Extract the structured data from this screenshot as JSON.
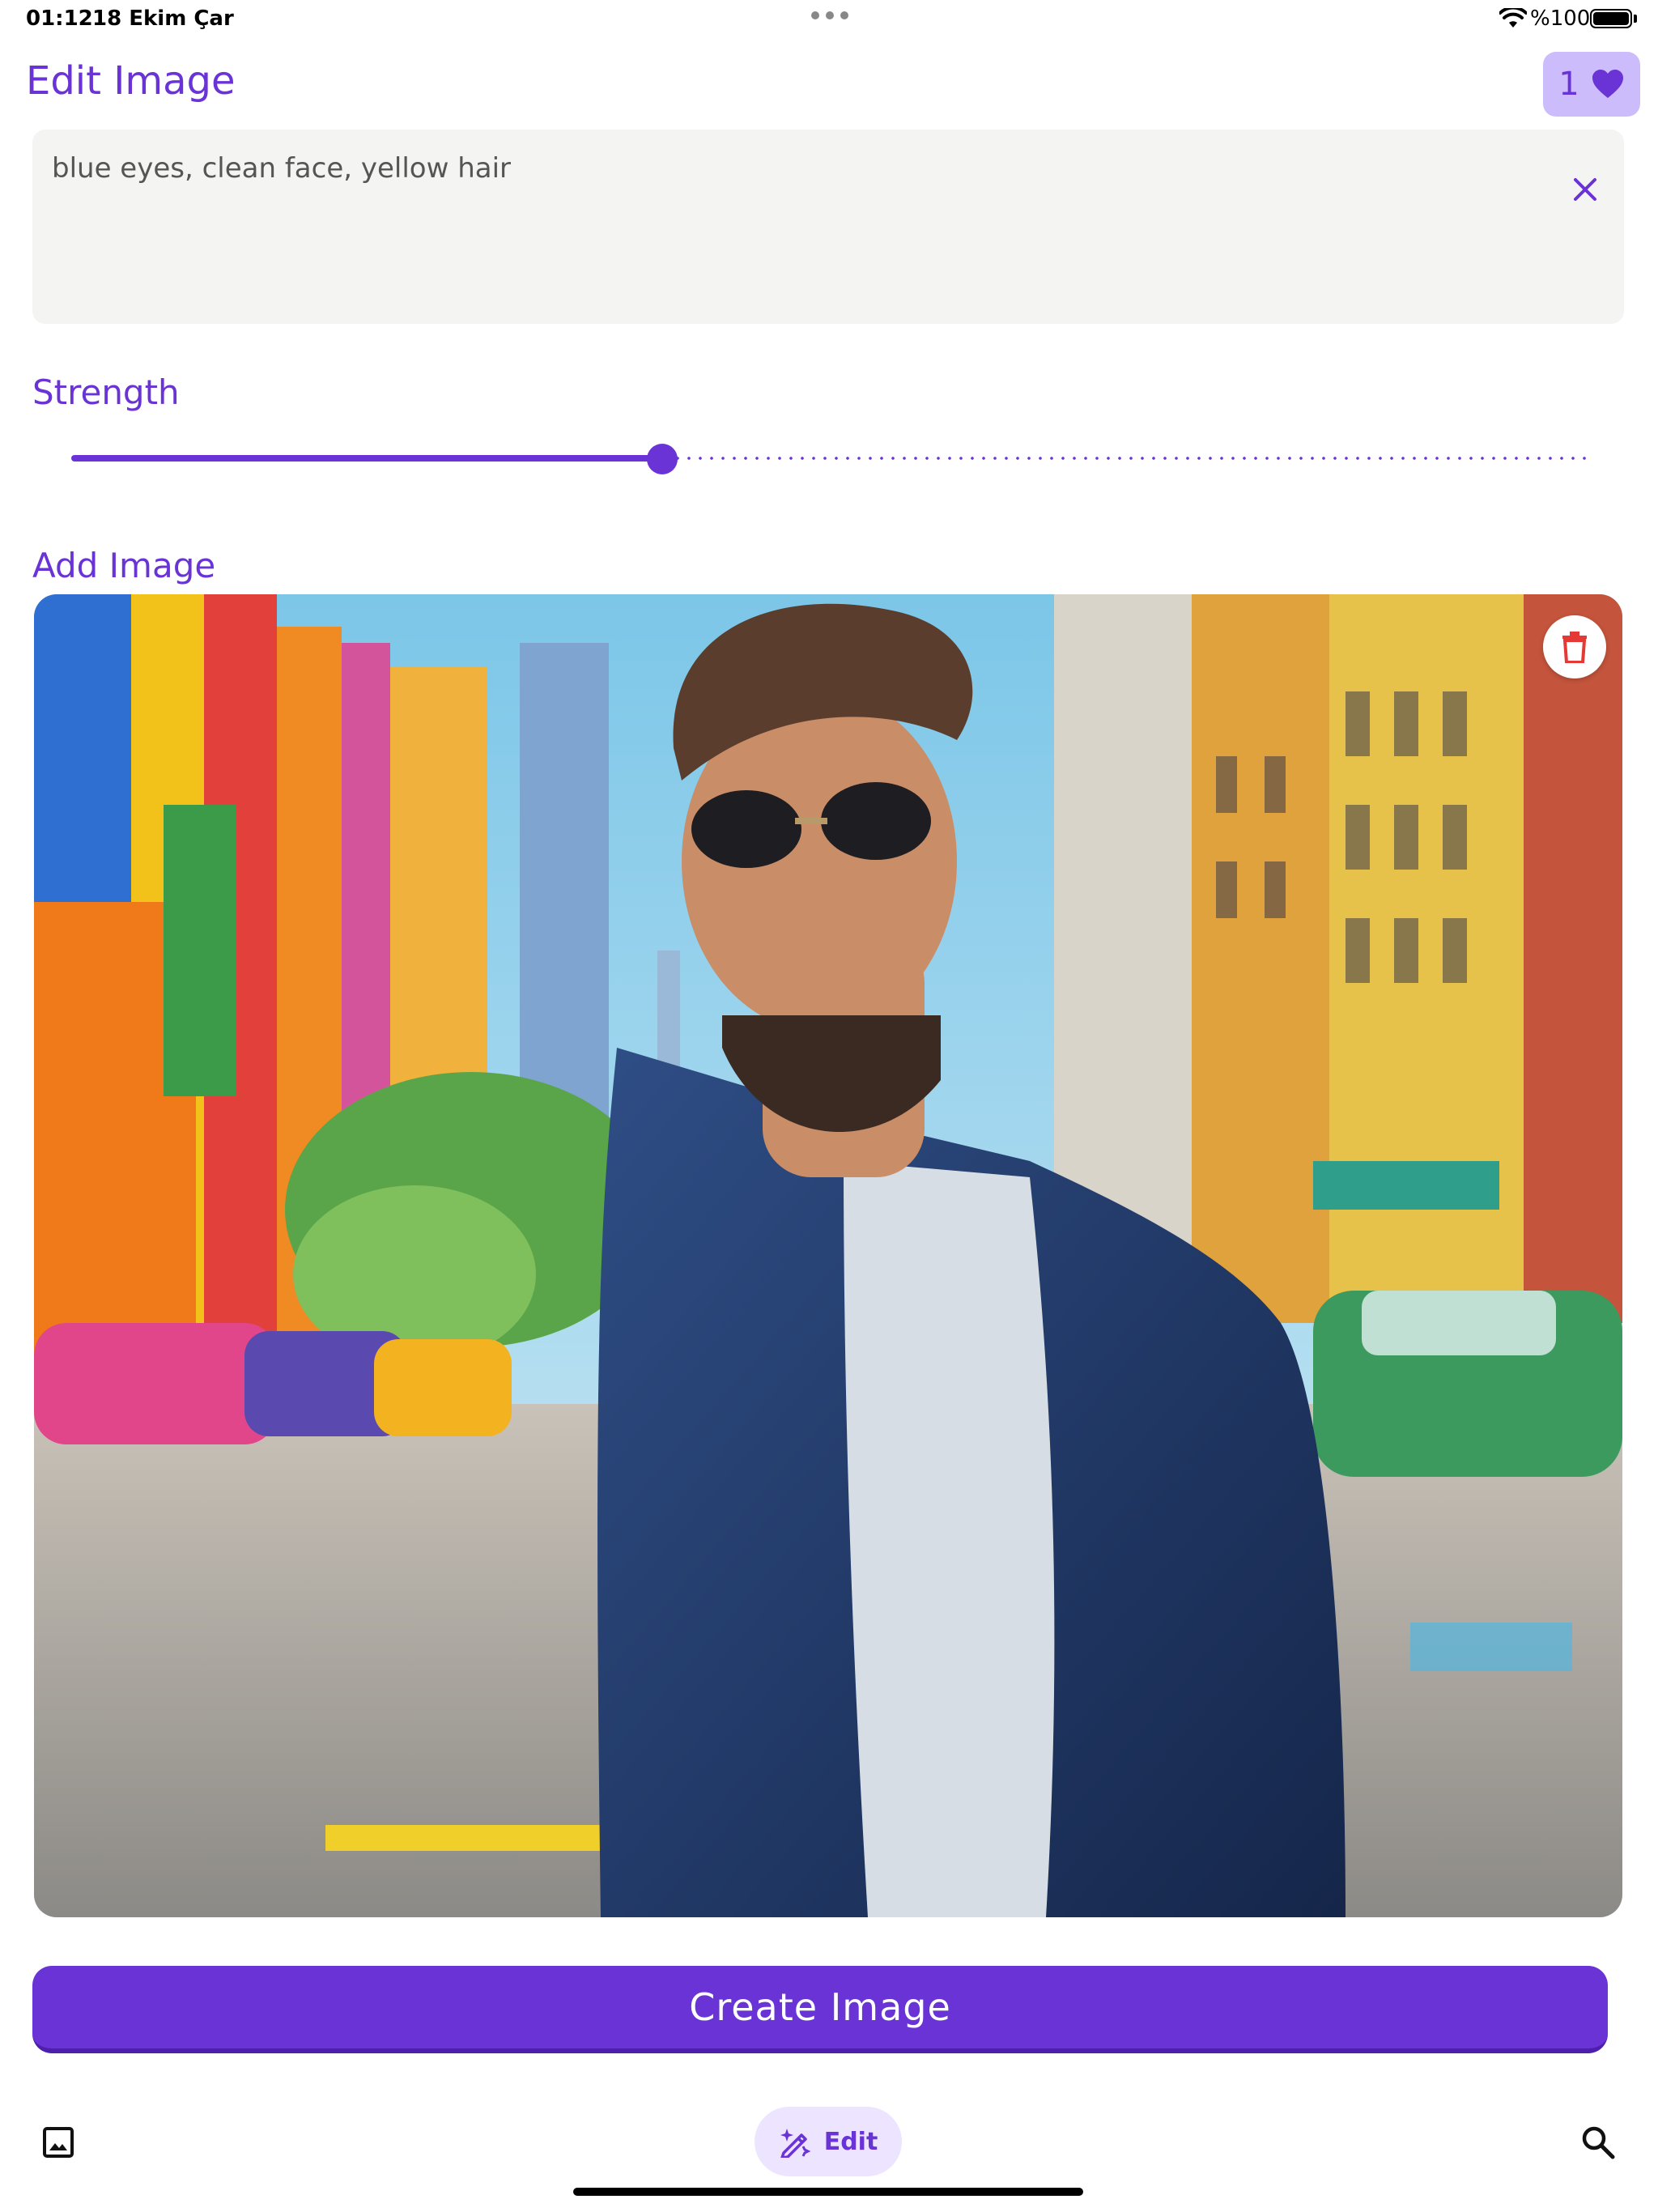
{
  "status_bar": {
    "time": "01:12",
    "date": "18 Ekim Çar",
    "battery_text": "%100"
  },
  "header": {
    "title": "Edit Image",
    "favorites_count": "1",
    "favorites_icon": "heart-icon"
  },
  "prompt": {
    "value": "blue eyes, clean face, yellow hair",
    "clear_icon": "close-icon"
  },
  "strength": {
    "label": "Strength",
    "value_fraction": 0.39
  },
  "add_image": {
    "label": "Add Image",
    "delete_icon": "trash-icon"
  },
  "create_button": {
    "label": "Create Image"
  },
  "bottom_nav": {
    "gallery_icon": "image-icon",
    "edit_label": "Edit",
    "edit_icon": "magic-pen-icon",
    "search_icon": "search-icon"
  },
  "colors": {
    "accent": "#6a33d6",
    "badge_bg": "#cdbcfb",
    "prompt_bg": "#f4f5f2",
    "nav_pill_bg": "#ede4ff",
    "delete_red": "#e53935"
  }
}
